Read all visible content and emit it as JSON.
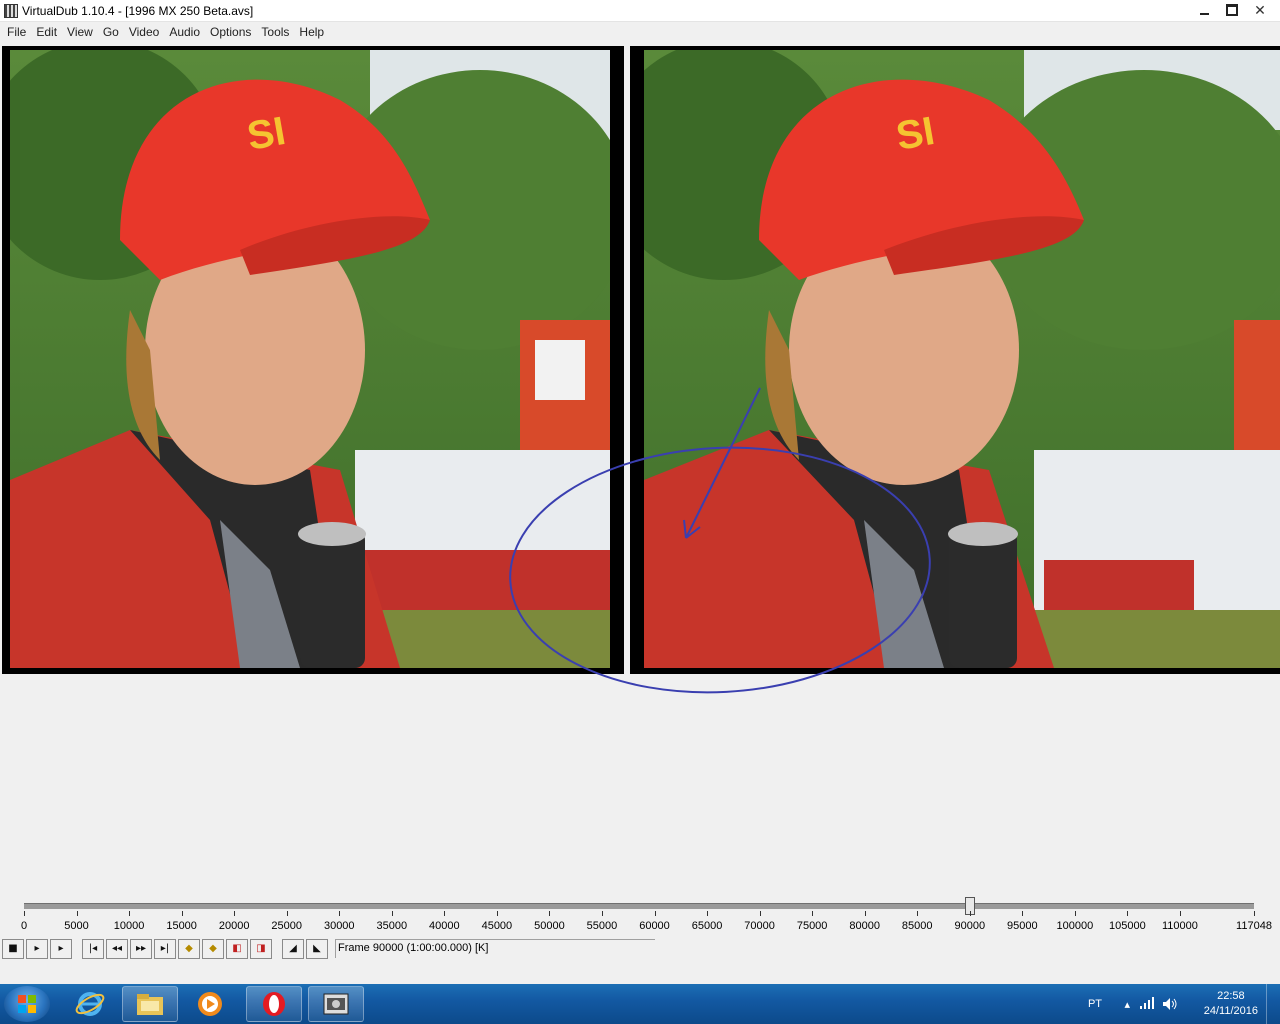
{
  "window": {
    "title": "VirtualDub 1.10.4 - [1996 MX 250 Beta.avs]",
    "controls": [
      "minimize",
      "maximize",
      "close"
    ]
  },
  "menu": [
    "File",
    "Edit",
    "View",
    "Go",
    "Video",
    "Audio",
    "Options",
    "Tools",
    "Help"
  ],
  "timeline": {
    "ticks": [
      "0",
      "5000",
      "10000",
      "15000",
      "20000",
      "25000",
      "30000",
      "35000",
      "40000",
      "45000",
      "50000",
      "55000",
      "60000",
      "65000",
      "70000",
      "75000",
      "80000",
      "85000",
      "90000",
      "95000",
      "100000",
      "105000",
      "110000",
      "117048"
    ],
    "max_frame": 117048,
    "current_frame": 90000
  },
  "toolbar": {
    "buttons": [
      "stop-icon",
      "play-input-icon",
      "play-output-icon",
      "go-start-icon",
      "step-back-icon",
      "step-forward-icon",
      "go-end-icon",
      "prev-keyframe-icon",
      "next-keyframe-icon",
      "scene-back-icon",
      "scene-forward-icon",
      "mark-in-icon",
      "mark-out-icon"
    ],
    "status": "Frame 90000 (1:00:00.000) [K]"
  },
  "taskbar": {
    "apps": [
      "internet-explorer-icon",
      "file-explorer-icon",
      "media-player-icon",
      "opera-icon",
      "virtualdub-icon"
    ],
    "language": "PT",
    "time": "22:58",
    "date": "24/11/2016"
  },
  "colors": {
    "annotation": "#3a3fb0",
    "taskbar": "#1359a3",
    "cap_red": "#e8372a"
  }
}
